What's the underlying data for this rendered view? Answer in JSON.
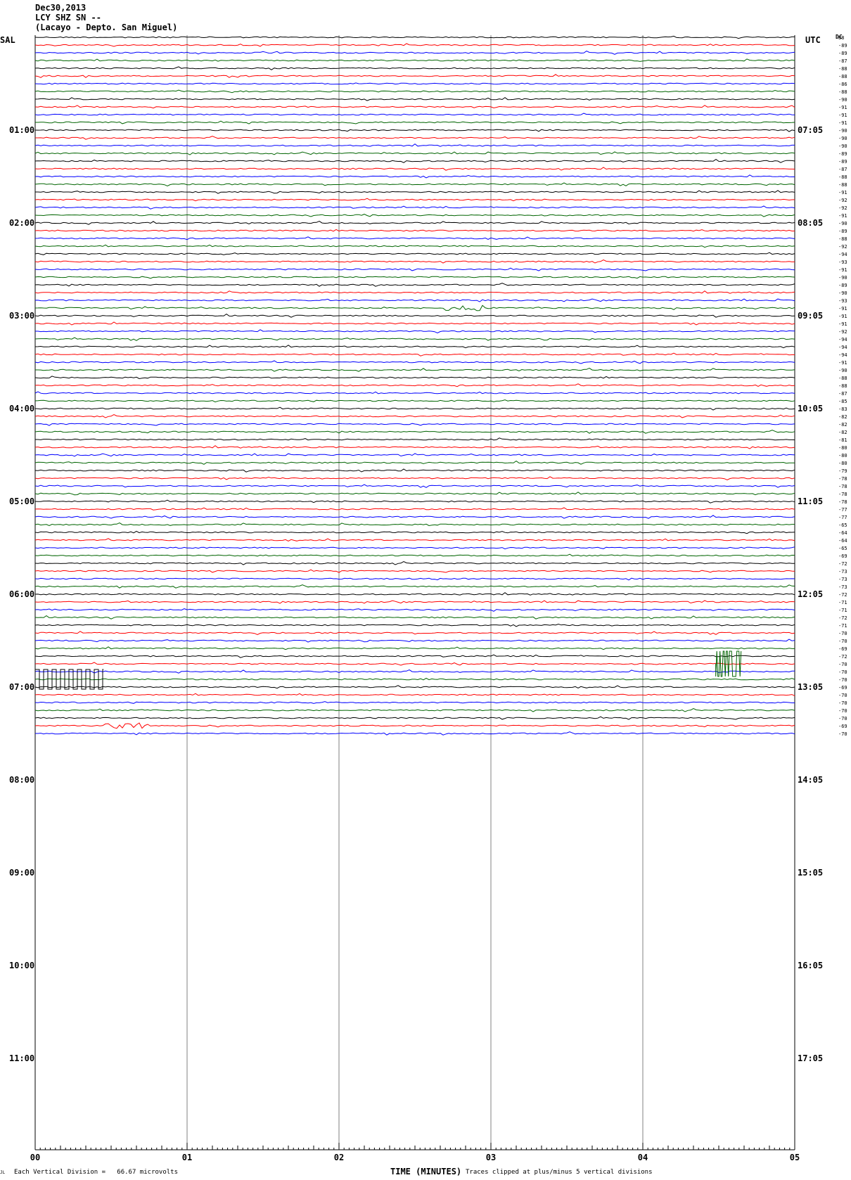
{
  "header": {
    "date": "Dec30,2013",
    "channel": "LCY SHZ SN --",
    "location": "(Lacayo - Depto. San Miguel)"
  },
  "left_zone": "SAL",
  "right_zone": "UTC",
  "dc_label": "DC",
  "footer": {
    "scale_note": "Each Vertical Division =   66.67 microvolts",
    "clip_note": "Traces clipped at plus/minus 5 vertical divisions",
    "corner_mark": "JL"
  },
  "colors": {
    "black": "#000000",
    "red": "#ff0000",
    "blue": "#0000ff",
    "green": "#006400",
    "grid": "#808080"
  },
  "chart_data": {
    "type": "line",
    "title": "",
    "xlabel": "TIME (MINUTES)",
    "xlim": [
      0,
      5
    ],
    "x_ticks": [
      "00",
      "01",
      "02",
      "03",
      "04",
      "05"
    ],
    "left_hour_labels": [
      "01:00",
      "02:00",
      "03:00",
      "04:00",
      "05:00",
      "06:00",
      "07:00",
      "08:00",
      "09:00",
      "10:00",
      "11:00"
    ],
    "right_hour_labels": [
      "07:05",
      "08:05",
      "09:05",
      "10:05",
      "11:05",
      "12:05",
      "13:05",
      "14:05",
      "15:05",
      "16:05",
      "17:05"
    ],
    "trace_colors_cycle": [
      "black",
      "red",
      "blue",
      "green"
    ],
    "trace_count": 91,
    "dc_offsets": [
      "88",
      "-89",
      "-89",
      "-87",
      "-88",
      "-88",
      "-86",
      "-88",
      "-90",
      "-91",
      "-91",
      "-91",
      "-90",
      "-90",
      "-90",
      "-89",
      "-89",
      "-87",
      "-88",
      "-88",
      "-91",
      "-92",
      "-92",
      "-91",
      "-90",
      "-89",
      "-88",
      "-92",
      "-94",
      "-93",
      "-91",
      "-90",
      "-89",
      "-90",
      "-93",
      "-91",
      "-91",
      "-91",
      "-92",
      "-94",
      "-94",
      "-94",
      "-91",
      "-90",
      "-88",
      "-88",
      "-87",
      "-85",
      "-83",
      "-82",
      "-82",
      "-82",
      "-81",
      "-80",
      "-80",
      "-80",
      "-79",
      "-78",
      "-78",
      "-78",
      "-78",
      "-77",
      "-77",
      "-65",
      "-64",
      "-64",
      "-65",
      "-69",
      "-72",
      "-73",
      "-73",
      "-73",
      "-72",
      "-71",
      "-71",
      "-72",
      "-71",
      "-70",
      "-70",
      "-69",
      "-72",
      "-70",
      "-70",
      "-70",
      "-69",
      "-70",
      "-70",
      "-70",
      "-70",
      "-69",
      "-70"
    ],
    "events": [
      {
        "row": 83,
        "minute_start": 0.0,
        "minute_end": 0.45,
        "kind": "square-wave calibration"
      },
      {
        "row": 81,
        "minute_start": 4.48,
        "minute_end": 4.65,
        "kind": "saturated burst"
      },
      {
        "row": 35,
        "minute_start": 2.7,
        "minute_end": 2.95,
        "kind": "local event"
      },
      {
        "row": 89,
        "minute_start": 0.45,
        "minute_end": 0.75,
        "kind": "local event"
      }
    ]
  }
}
